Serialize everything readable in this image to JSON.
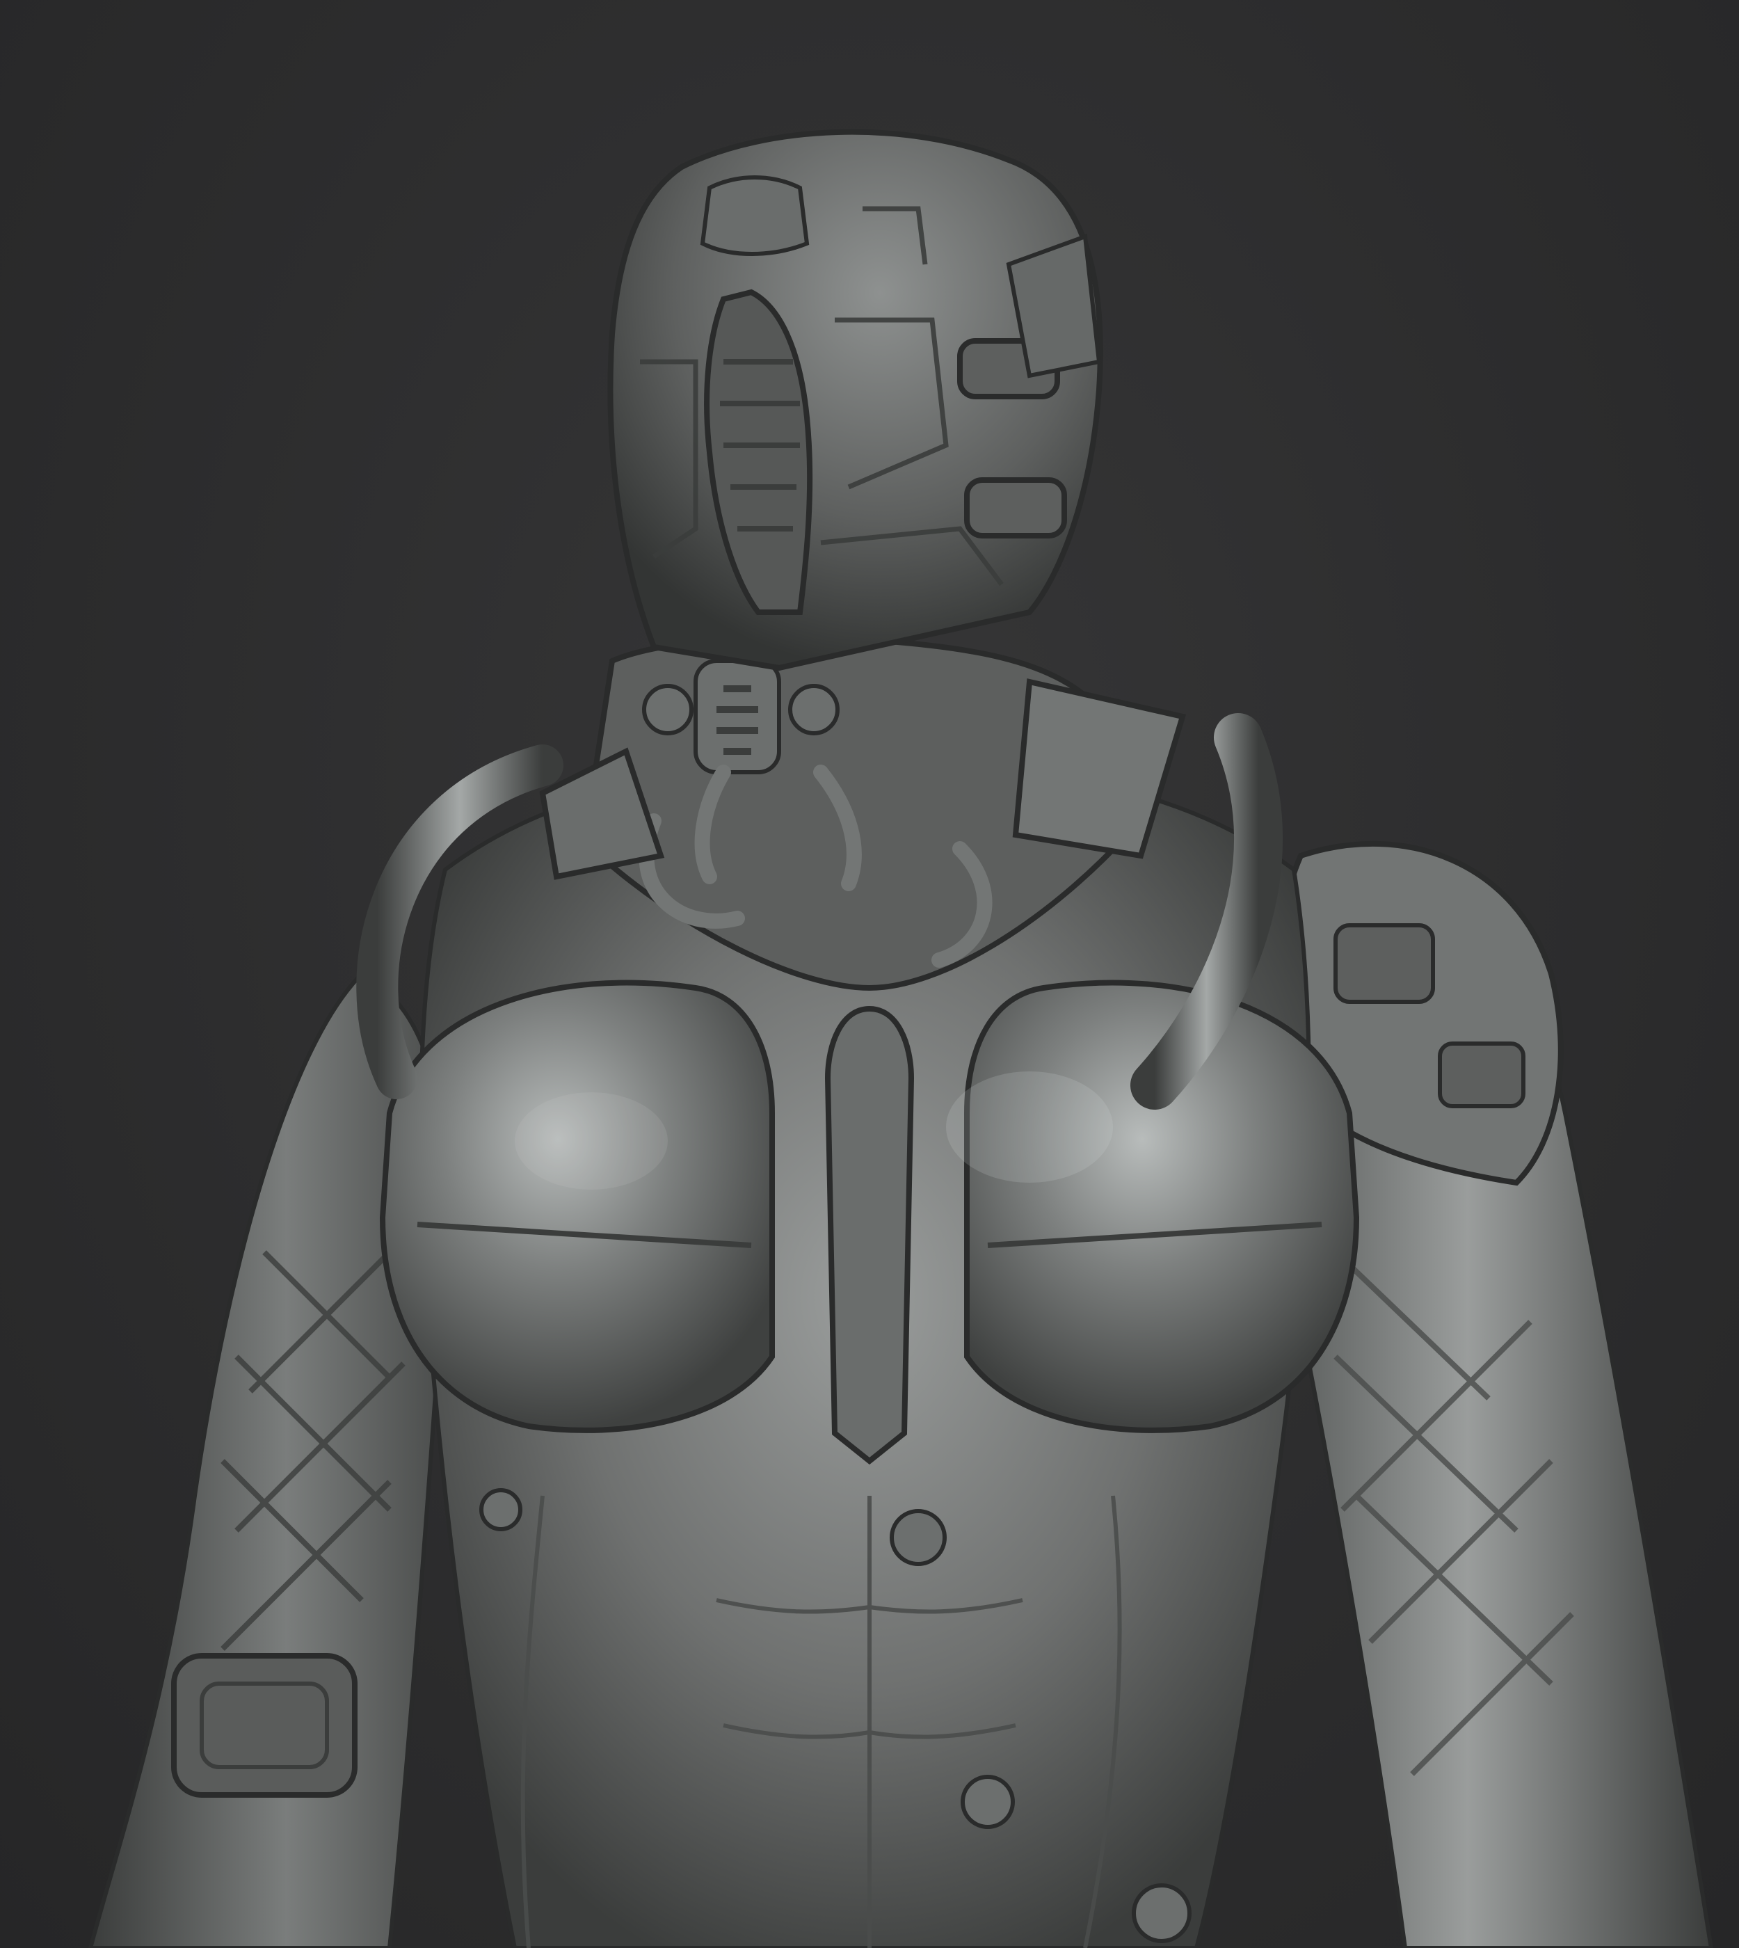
{
  "scene": {
    "subject_icon": "armored-figure-sculpt",
    "colors": {
      "background": "#2e2e2f",
      "clay_base": "#6f7170",
      "clay_light": "#9a9d9c",
      "clay_highlight": "#c3c7c6",
      "clay_shadow": "#3b3d3c",
      "clay_deep": "#2a2b2b"
    }
  }
}
